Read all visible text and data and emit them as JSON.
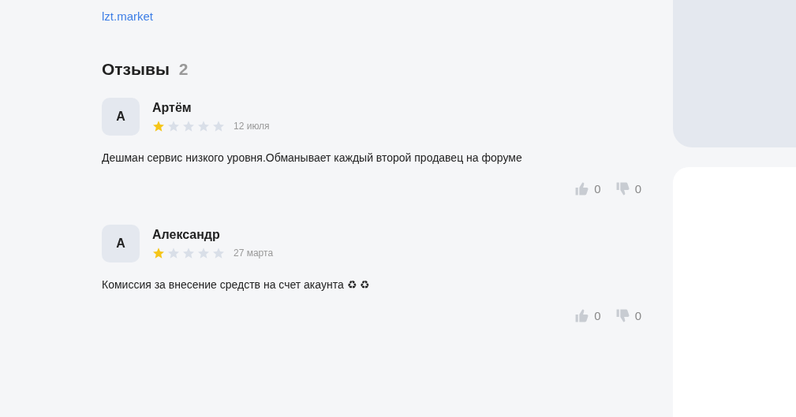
{
  "link": "lzt.market",
  "reviews_header": {
    "title": "Отзывы",
    "count": "2"
  },
  "reviews": [
    {
      "avatar": "А",
      "author": "Артём",
      "stars": 1,
      "date": "12 июля",
      "text": "Дешман сервис низкого уровня.Обманывает каждый второй продавец на форуме",
      "likes": "0",
      "dislikes": "0"
    },
    {
      "avatar": "А",
      "author": "Александр",
      "stars": 1,
      "date": "27 марта",
      "text": "Комиссия за внесение средств на счет акаунта ♻ ♻",
      "likes": "0",
      "dislikes": "0"
    }
  ]
}
